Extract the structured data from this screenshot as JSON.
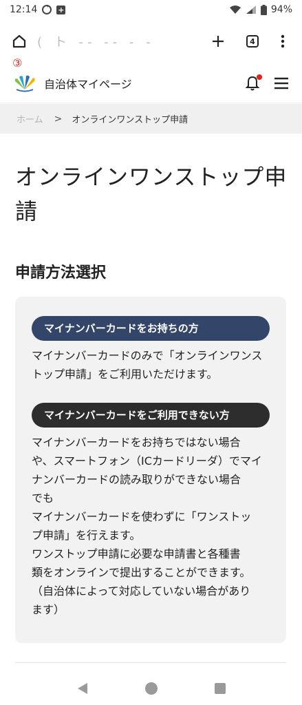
{
  "status_bar": {
    "time": "12:14",
    "battery": "94%"
  },
  "browser": {
    "url": "( ト ‐‐ ‐‐ ‐ ‐",
    "tab_count": "4"
  },
  "site": {
    "marker": "③",
    "title": "自治体マイページ",
    "logo_colors": [
      "#7cc24a",
      "#2aa7c9",
      "#f0b400",
      "#2e6cb8"
    ]
  },
  "breadcrumb": {
    "home": "ホーム",
    "separator": ">",
    "current": "オンラインワンストップ申請"
  },
  "main": {
    "page_title": "オンラインワンストップ申請",
    "section_title": "申請方法選択",
    "options": [
      {
        "label": "マイナンバーカードをお持ちの方",
        "color": "#334569",
        "lines": [
          "マイナンバーカードのみで「オンラインワンス",
          "トップ申請」をご利用いただけます。"
        ]
      },
      {
        "label": "マイナンバーカードをご利用できない方",
        "color": "#2d2d2d",
        "lines": [
          "マイナンバーカードをお持ちではない場合",
          "や、スマートフォン（ICカードリーダ）でマイ",
          "ナンバーカードの読み取りができない場合",
          "でも",
          "マイナンバーカードを使わずに「ワンストッ",
          "プ申請」を行えます。",
          "ワンストップ申請に必要な申請書と各種書",
          "類をオンラインで提出することができます。",
          "（自治体によって対応していない場合があり",
          "ます）"
        ]
      }
    ]
  },
  "icons": {
    "home": "home-icon",
    "new_tab": "plus-icon",
    "tabs": "tab-switcher-icon",
    "more": "more-vertical-icon",
    "bell": "bell-icon",
    "menu": "hamburger-menu-icon",
    "back": "back-icon",
    "home_nav": "home-circle-icon",
    "recents": "recents-icon"
  }
}
